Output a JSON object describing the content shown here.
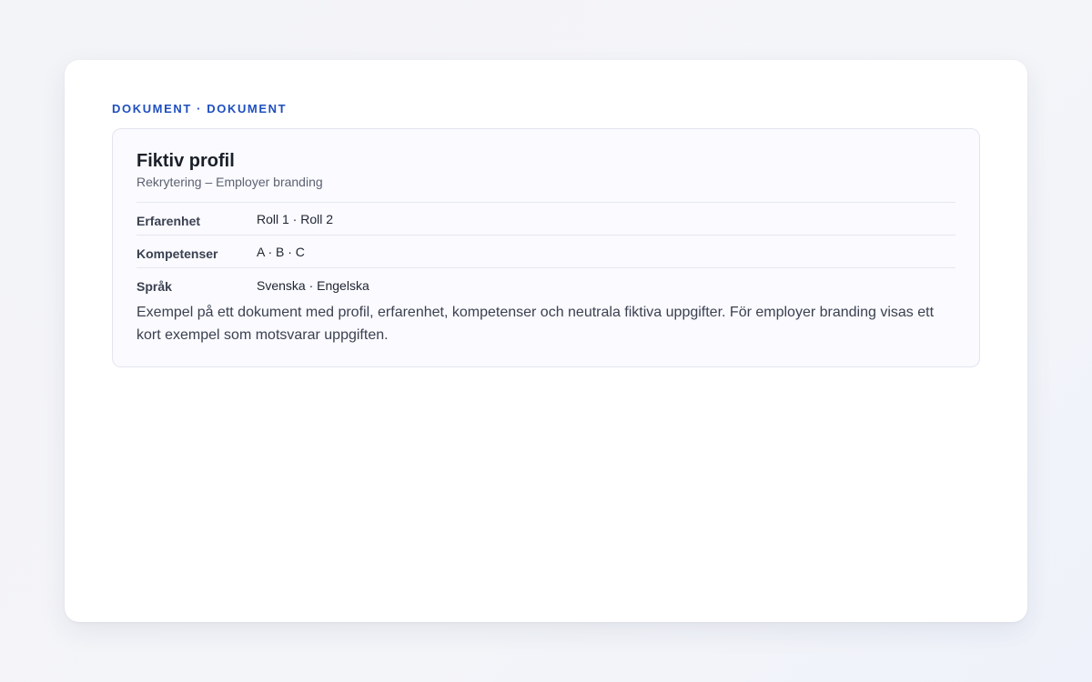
{
  "header": {
    "eyebrow": "DOKUMENT · DOKUMENT"
  },
  "profile": {
    "title": "Fiktiv profil",
    "subtitle": "Rekrytering – Employer branding",
    "rows": [
      {
        "label": "Erfarenhet",
        "value": "Roll 1 · Roll 2"
      },
      {
        "label": "Kompetenser",
        "value": "A · B · C"
      },
      {
        "label": "Språk",
        "value": "Svenska · Engelska"
      }
    ],
    "description": "Exempel på ett dokument med profil, erfarenhet, kompetenser och neutrala fiktiva uppgifter. För employer branding visas ett kort exempel som motsvarar uppgiften."
  },
  "colors": {
    "accent": "#1f4fbf",
    "panel_background": "#fafaff",
    "panel_border": "#e3e5ef"
  }
}
